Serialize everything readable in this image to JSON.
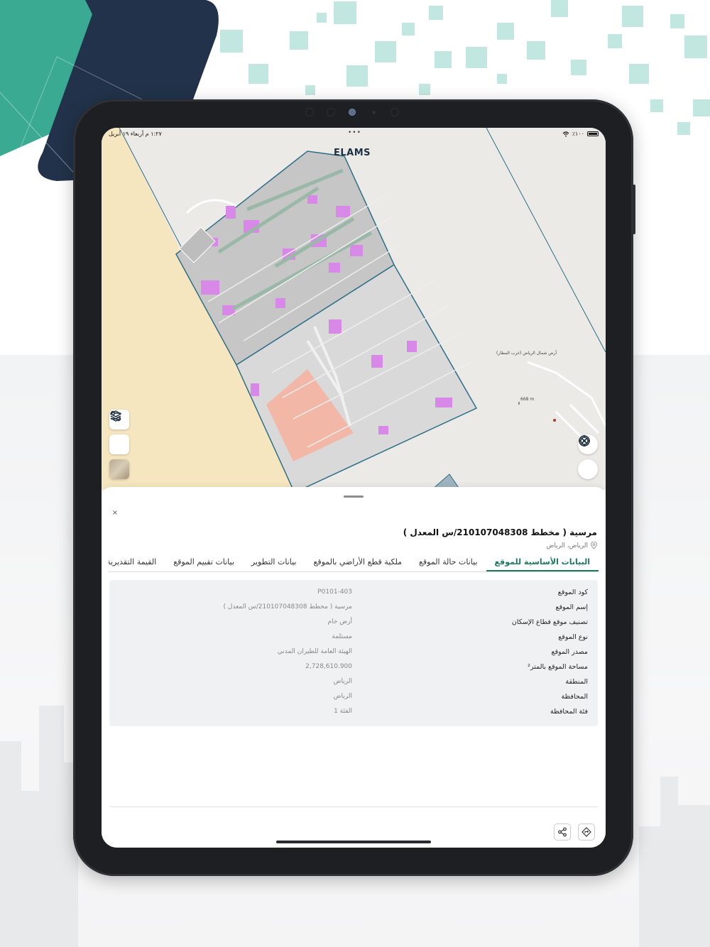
{
  "status_bar": {
    "time": "١:٢٧ م  أربعاء ١٩ أبريل",
    "dots": "•••",
    "battery": "٪١٠٠"
  },
  "map": {
    "logo": "ELAMS",
    "area_label": "أرض شمال الرياض (غرب المطار)",
    "distance_label": "668 m"
  },
  "icons": {
    "filter": "filter-icon",
    "layers": "layers-icon",
    "basemap": "basemap-thumbnail",
    "compass": "compass-icon",
    "locate": "locate-icon",
    "close": "close-icon",
    "location": "location-pin-icon",
    "share": "share-icon",
    "directions": "directions-icon"
  },
  "sheet": {
    "close": "×",
    "title": "مرسية ( مخطط 210107048308/س المعدل )",
    "location": "الرياض، الرياض",
    "tabs": [
      {
        "label": "البيانات الأساسية للموقع"
      },
      {
        "label": "بيانات حالة الموقع"
      },
      {
        "label": "ملكية قطع الأراضي بالموقع"
      },
      {
        "label": "بيانات التطوير"
      },
      {
        "label": "بيانات تقييم الموقع"
      },
      {
        "label": "القيمة التقديرية"
      }
    ],
    "rows": [
      {
        "label": "كود الموقع",
        "value": "P0101-403"
      },
      {
        "label": "إسم الموقع",
        "value": "مرسية ( مخطط 210107048308/س المعدل )"
      },
      {
        "label": "تصنيف موقع قطاع الإسكان",
        "value": "أرض خام"
      },
      {
        "label": "نوع الموقع",
        "value": "مستلمة"
      },
      {
        "label": "مصدر الموقع",
        "value": "الهيئة العامة للطيران المدني"
      },
      {
        "label": "مساحة الموقع بالمتر²",
        "value": "2,728,610.900"
      },
      {
        "label": "المنطقة",
        "value": "الرياض"
      },
      {
        "label": "المحافظة",
        "value": "الرياض"
      },
      {
        "label": "فئة المحافظة",
        "value": "الفئة 1"
      }
    ]
  },
  "colors": {
    "accent": "#1d7a5a",
    "teal": "#3aaa93",
    "navy": "#21324a"
  }
}
